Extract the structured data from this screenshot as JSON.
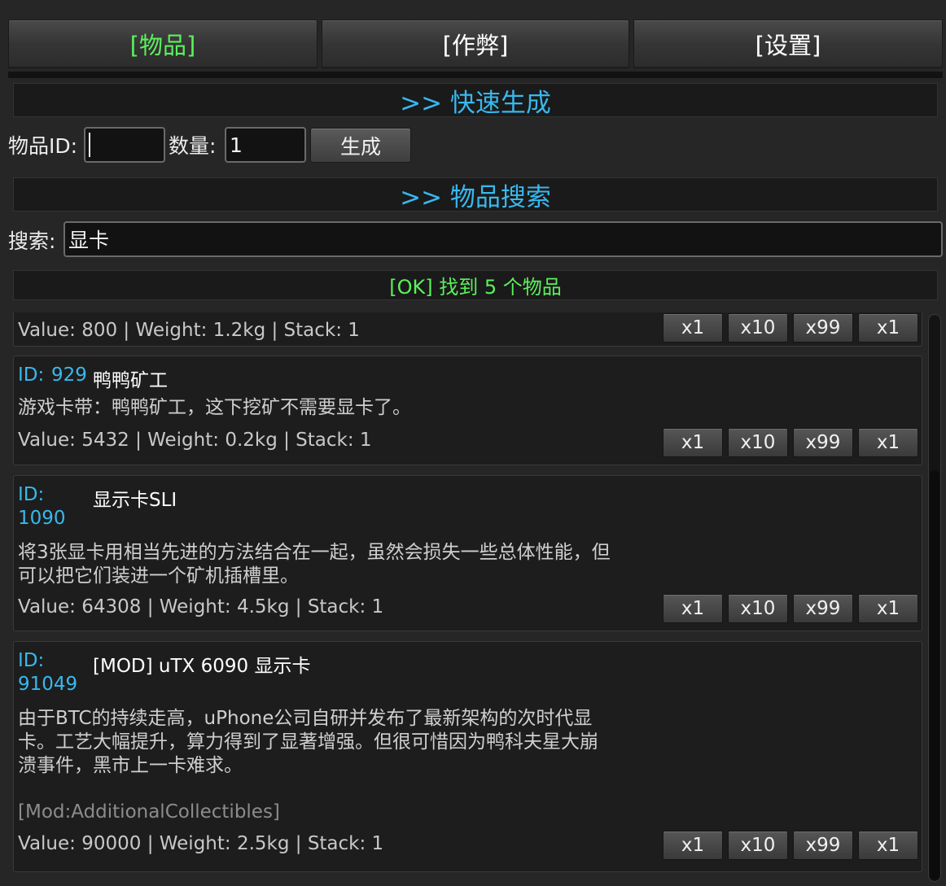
{
  "tabs": [
    {
      "label": "[物品]",
      "active": true
    },
    {
      "label": "[作弊]",
      "active": false
    },
    {
      "label": "[设置]",
      "active": false
    }
  ],
  "quick_generate": {
    "header": ">> 快速生成",
    "id_label": "物品ID:",
    "id_value": "",
    "qty_label": "数量:",
    "qty_value": "1",
    "generate_label": "生成"
  },
  "item_search": {
    "header": ">> 物品搜索",
    "search_label": "搜索:",
    "search_value": "显卡"
  },
  "result_status": "[OK] 找到 5 个物品",
  "quantity_buttons": [
    "x1",
    "x10",
    "x99",
    "x1"
  ],
  "items": [
    {
      "stats": "Value: 800 | Weight: 1.2kg | Stack: 1"
    },
    {
      "id_label": "ID:",
      "id": "929",
      "name": "鸭鸭矿工",
      "description": "游戏卡带：鸭鸭矿工，这下挖矿不需要显卡了。",
      "stats": "Value: 5432 | Weight: 0.2kg | Stack: 1"
    },
    {
      "id_label": "ID:",
      "id": "1090",
      "name": "显示卡SLI",
      "description": "将3张显卡用相当先进的方法结合在一起，虽然会损失一些总体性能，但可以把它们装进一个矿机插槽里。",
      "stats": "Value: 64308 | Weight: 4.5kg | Stack: 1"
    },
    {
      "id_label": "ID:",
      "id": "91049",
      "name": "[MOD] uTX 6090 显示卡",
      "description": "由于BTC的持续走高，uPhone公司自研并发布了最新架构的次时代显卡。工艺大幅提升，算力得到了显著增强。但很可惜因为鸭科夫星大崩溃事件，黑市上一卡难求。",
      "mod_tag": "[Mod:AdditionalCollectibles]",
      "stats": "Value: 90000 | Weight: 2.5kg | Stack: 1"
    }
  ],
  "colors": {
    "accent_blue": "#38b8ee",
    "active_green": "#5cf05c",
    "background": "#262626"
  }
}
